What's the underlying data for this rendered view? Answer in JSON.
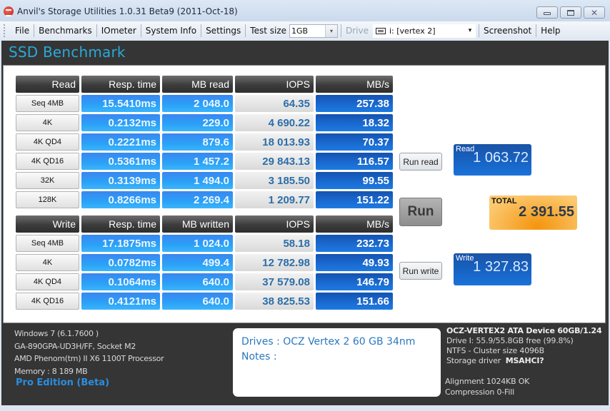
{
  "window": {
    "title": "Anvil's Storage Utilities 1.0.31 Beta9 (2011-Oct-18)",
    "controls": {
      "minimize": "minimize",
      "maximize": "maximize",
      "close": "✕"
    }
  },
  "menu": {
    "items": [
      "File",
      "Benchmarks",
      "IOmeter",
      "System Info",
      "Settings"
    ],
    "test_size_label": "Test size",
    "test_size_value": "1GB",
    "drive_label": "Drive",
    "drive_value": "i: [vertex 2]",
    "screenshot": "Screenshot",
    "help": "Help",
    "dropdown_glyph": "▾"
  },
  "page_title": "SSD Benchmark",
  "read_table": {
    "headers": [
      "Read",
      "Resp. time",
      "MB read",
      "IOPS",
      "MB/s"
    ],
    "rows": [
      {
        "label": "Seq 4MB",
        "resp": "15.5410ms",
        "mb": "2 048.0",
        "iops": "64.35",
        "mbs": "257.38"
      },
      {
        "label": "4K",
        "resp": "0.2132ms",
        "mb": "229.0",
        "iops": "4 690.22",
        "mbs": "18.32"
      },
      {
        "label": "4K QD4",
        "resp": "0.2221ms",
        "mb": "879.6",
        "iops": "18 013.93",
        "mbs": "70.37"
      },
      {
        "label": "4K QD16",
        "resp": "0.5361ms",
        "mb": "1 457.2",
        "iops": "29 843.13",
        "mbs": "116.57"
      },
      {
        "label": "32K",
        "resp": "0.3139ms",
        "mb": "1 494.0",
        "iops": "3 185.50",
        "mbs": "99.55"
      },
      {
        "label": "128K",
        "resp": "0.8266ms",
        "mb": "2 269.4",
        "iops": "1 209.77",
        "mbs": "151.22"
      }
    ]
  },
  "write_table": {
    "headers": [
      "Write",
      "Resp. time",
      "MB written",
      "IOPS",
      "MB/s"
    ],
    "rows": [
      {
        "label": "Seq 4MB",
        "resp": "17.1875ms",
        "mb": "1 024.0",
        "iops": "58.18",
        "mbs": "232.73"
      },
      {
        "label": "4K",
        "resp": "0.0782ms",
        "mb": "499.4",
        "iops": "12 782.98",
        "mbs": "49.93"
      },
      {
        "label": "4K QD4",
        "resp": "0.1064ms",
        "mb": "640.0",
        "iops": "37 579.08",
        "mbs": "146.79"
      },
      {
        "label": "4K QD16",
        "resp": "0.4121ms",
        "mb": "640.0",
        "iops": "38 825.53",
        "mbs": "151.66"
      }
    ]
  },
  "controls": {
    "run_read": "Run read",
    "run": "Run",
    "run_write": "Run write"
  },
  "scores": {
    "read_label": "Read",
    "read_value": "1 063.72",
    "total_label": "TOTAL",
    "total_value": "2 391.55",
    "write_label": "Write",
    "write_value": "1 327.83"
  },
  "system_info": {
    "lines": [
      "Windows 7 (6.1.7600 )",
      "GA-890GPA-UD3H/FF, Socket M2",
      "AMD Phenom(tm) II X6 1100T Processor",
      "Memory : 8 189 MB"
    ],
    "edition": "Pro Edition (Beta)"
  },
  "notes": {
    "drives": "Drives : OCZ Vertex 2 60 GB 34nm",
    "notes": "Notes :"
  },
  "device_info": {
    "device": "OCZ-VERTEX2 ATA Device 60GB/1.24",
    "drive": "Drive I: 55.9/55.8GB free (99.8%)",
    "fs": "NTFS - Cluster size 4096B",
    "driver_label": "Storage driver",
    "driver_value": "MSAHCI?",
    "alignment": "Alignment 1024KB OK",
    "compression": "Compression 0-Fill"
  }
}
